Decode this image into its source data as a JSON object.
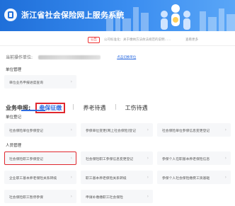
{
  "banner": {
    "title": "浙江省社会保险网上服务系统"
  },
  "notice": {
    "tag": "公告",
    "text": "公司标准化：关于缴纳方法依法规范的说明……",
    "more": "查看更多"
  },
  "current_unit": {
    "label": "当前操作单位:",
    "switch_label": "点击切换单位"
  },
  "sections": {
    "unit_manage": {
      "title": "单位管理",
      "items": [
        {
          "label": "单位业务申报进度查询"
        }
      ]
    },
    "business": {
      "label": "业务申报:",
      "tabs": [
        {
          "label": "参保征缴",
          "active": true
        },
        {
          "label": "养老待遇",
          "active": false
        },
        {
          "label": "工伤待遇",
          "active": false
        }
      ]
    },
    "unit_register": {
      "title": "单位登记",
      "items": [
        {
          "label": "社会保险单位参保登记"
        },
        {
          "label": "参保单位变更(网上社会保险)登记"
        },
        {
          "label": "社会保险单位参保信息变更登记"
        }
      ]
    },
    "person_register": {
      "title": "人员管理",
      "items": [
        {
          "label": "社会保险职工参保登记",
          "highlighted": true
        },
        {
          "label": "社会保险职工参保信息变更登记"
        },
        {
          "label": "参保个人在职基本养老保险信息"
        },
        {
          "label": "企业职工基本养老保险关系转续"
        },
        {
          "label": "职工基本养老保险关系转续"
        },
        {
          "label": "参保个人社会保险缴费工资基础"
        },
        {
          "label": "社会保险职工暂停参保"
        },
        {
          "label": "申请补缴缴职工社会保险"
        }
      ]
    }
  },
  "colors": {
    "banner_start": "#1f6fd9",
    "accent": "#2d6ce0",
    "highlight": "#e0282e",
    "card_bg": "#f6f7f9"
  }
}
